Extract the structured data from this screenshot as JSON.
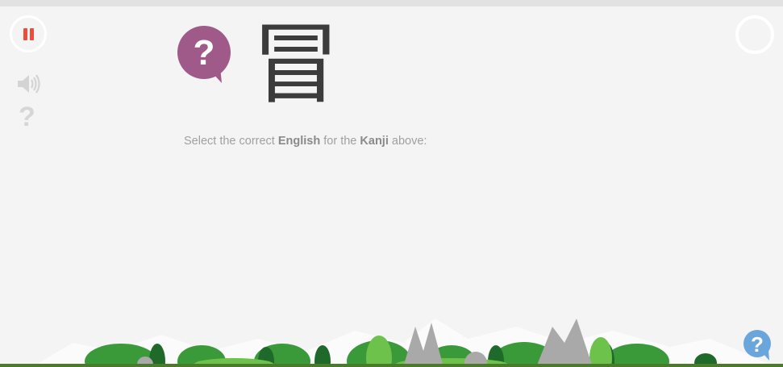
{
  "controls": {
    "pause": "pause-icon",
    "sound": "speaker-icon",
    "help_glyph": "?"
  },
  "question": {
    "kanji": "冒",
    "prompt_pre": "Select the correct ",
    "prompt_bold1": "English",
    "prompt_mid": " for the ",
    "prompt_bold2": "Kanji",
    "prompt_post": " above:"
  },
  "colors": {
    "accent": "#f04a3a",
    "bubble": "#a05a8a",
    "help": "#6aa6dc"
  }
}
